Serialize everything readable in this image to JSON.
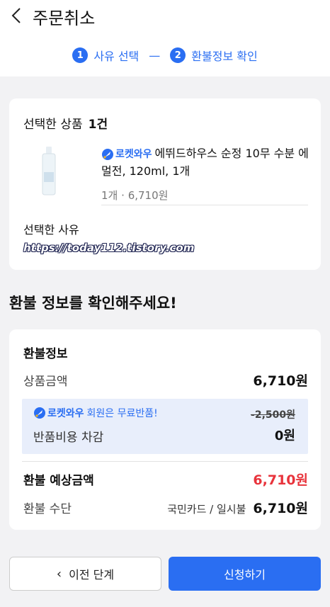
{
  "header": {
    "title": "주문취소"
  },
  "steps": [
    {
      "num": "1",
      "label": "사유 선택"
    },
    {
      "num": "2",
      "label": "환불정보 확인"
    }
  ],
  "step_separator": "—",
  "selected": {
    "label": "선택한 상품",
    "count": "1건",
    "rocket_label": "로켓와우",
    "product_name": "에뛰드하우스 순정 10무 수분 에멀전, 120ml, 1개",
    "quantity": "1개",
    "price": "6,710원",
    "reason_label": "선택한 사유",
    "reason_value": "https://today112.tistory.com"
  },
  "section_title": "환불 정보를 확인해주세요!",
  "refund": {
    "title": "환불정보",
    "product_amount_label": "상품금액",
    "product_amount": "6,710원",
    "promo_rocket": "로켓와우",
    "promo_text": "회원은 무료반품!",
    "promo_original_fee": "-2,500원",
    "return_fee_label": "반품비용 차감",
    "return_fee": "0원",
    "expected_label": "환불 예상금액",
    "expected_amount": "6,710원",
    "method_label": "환불 수단",
    "method_value": "국민카드 / 일시불",
    "method_amount": "6,710원"
  },
  "buttons": {
    "prev": "이전 단계",
    "apply": "신청하기"
  },
  "colors": {
    "accent": "#2a6ef2",
    "refund_red": "#e8343c",
    "promo_bg": "#e8eefb"
  }
}
